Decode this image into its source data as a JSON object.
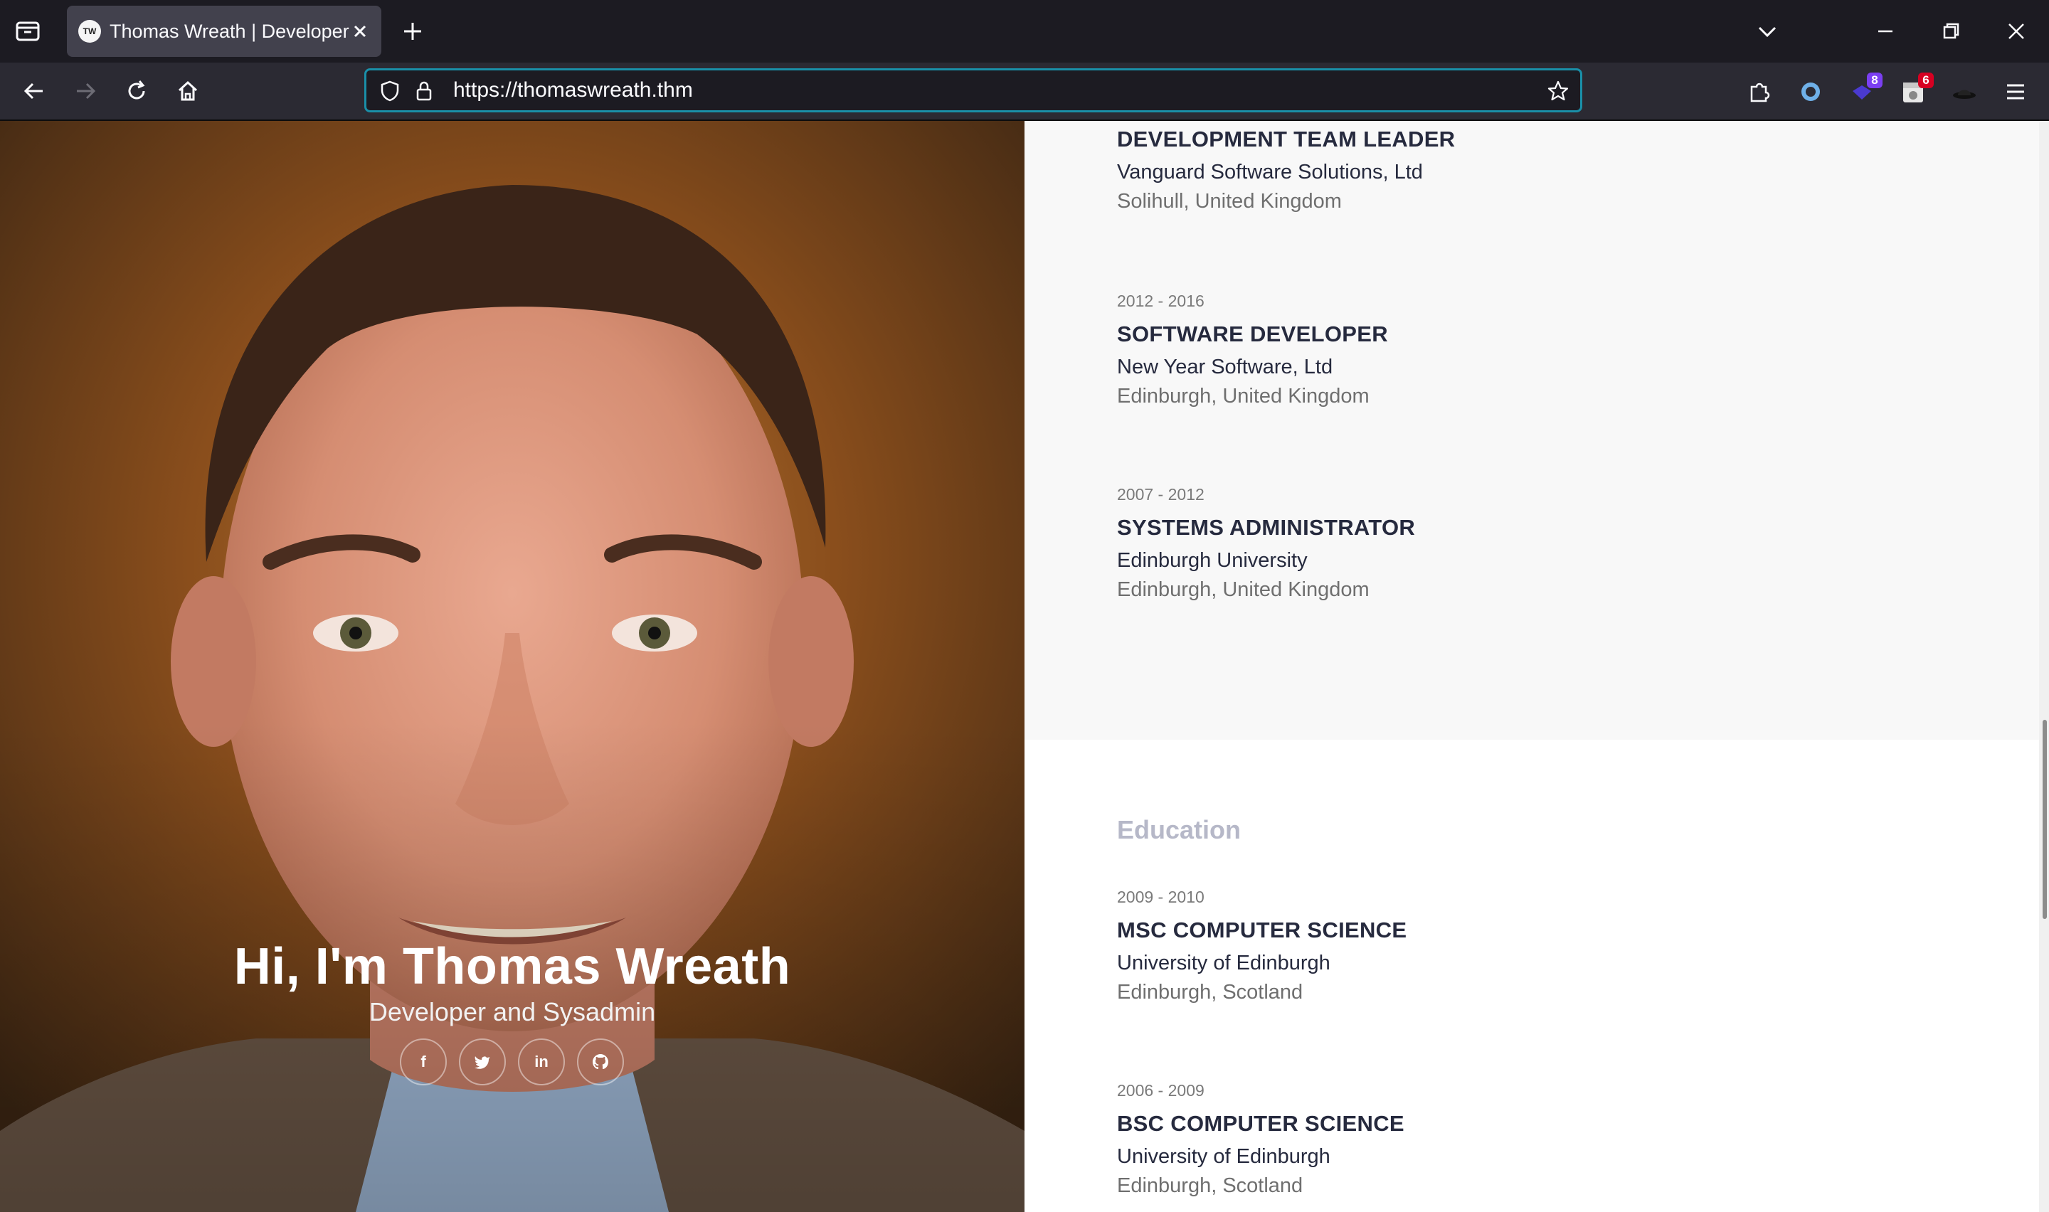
{
  "browser": {
    "tab_title": "Thomas Wreath | Developer",
    "favicon_text": "TW",
    "url": "https://thomaswreath.thm",
    "extensions": [
      {
        "name": "puzzle-icon",
        "badge": ""
      },
      {
        "name": "ring-extension-icon",
        "badge": ""
      },
      {
        "name": "shield-extension-icon",
        "badge": "8",
        "badge_color": "#7b3ff2"
      },
      {
        "name": "calendar-extension-icon",
        "badge": "6",
        "badge_color": "#d70022"
      },
      {
        "name": "hat-extension-icon",
        "badge": ""
      }
    ]
  },
  "hero": {
    "title": "Hi, I'm Thomas Wreath",
    "subtitle": "Developer and Sysadmin",
    "social": [
      {
        "name": "facebook",
        "glyph": "f"
      },
      {
        "name": "twitter",
        "glyph": "t"
      },
      {
        "name": "linkedin",
        "glyph": "in"
      },
      {
        "name": "github",
        "glyph": "gh"
      }
    ]
  },
  "experience": [
    {
      "years": "",
      "title": "DEVELOPMENT TEAM LEADER",
      "org": "Vanguard Software Solutions, Ltd",
      "location": "Solihull, United Kingdom"
    },
    {
      "years": "2012 - 2016",
      "title": "SOFTWARE DEVELOPER",
      "org": "New Year Software, Ltd",
      "location": "Edinburgh, United Kingdom"
    },
    {
      "years": "2007 - 2012",
      "title": "SYSTEMS ADMINISTRATOR",
      "org": "Edinburgh University",
      "location": "Edinburgh, United Kingdom"
    }
  ],
  "education": {
    "heading": "Education",
    "entries": [
      {
        "years": "2009 - 2010",
        "title": "MSC COMPUTER SCIENCE",
        "org": "University of Edinburgh",
        "location": "Edinburgh, Scotland"
      },
      {
        "years": "2006 - 2009",
        "title": "BSC COMPUTER SCIENCE",
        "org": "University of Edinburgh",
        "location": "Edinburgh, Scotland"
      }
    ]
  },
  "colors": {
    "accent": "#1a8fa8",
    "heading": "#262a3e",
    "muted_heading": "#b6b8c8"
  }
}
